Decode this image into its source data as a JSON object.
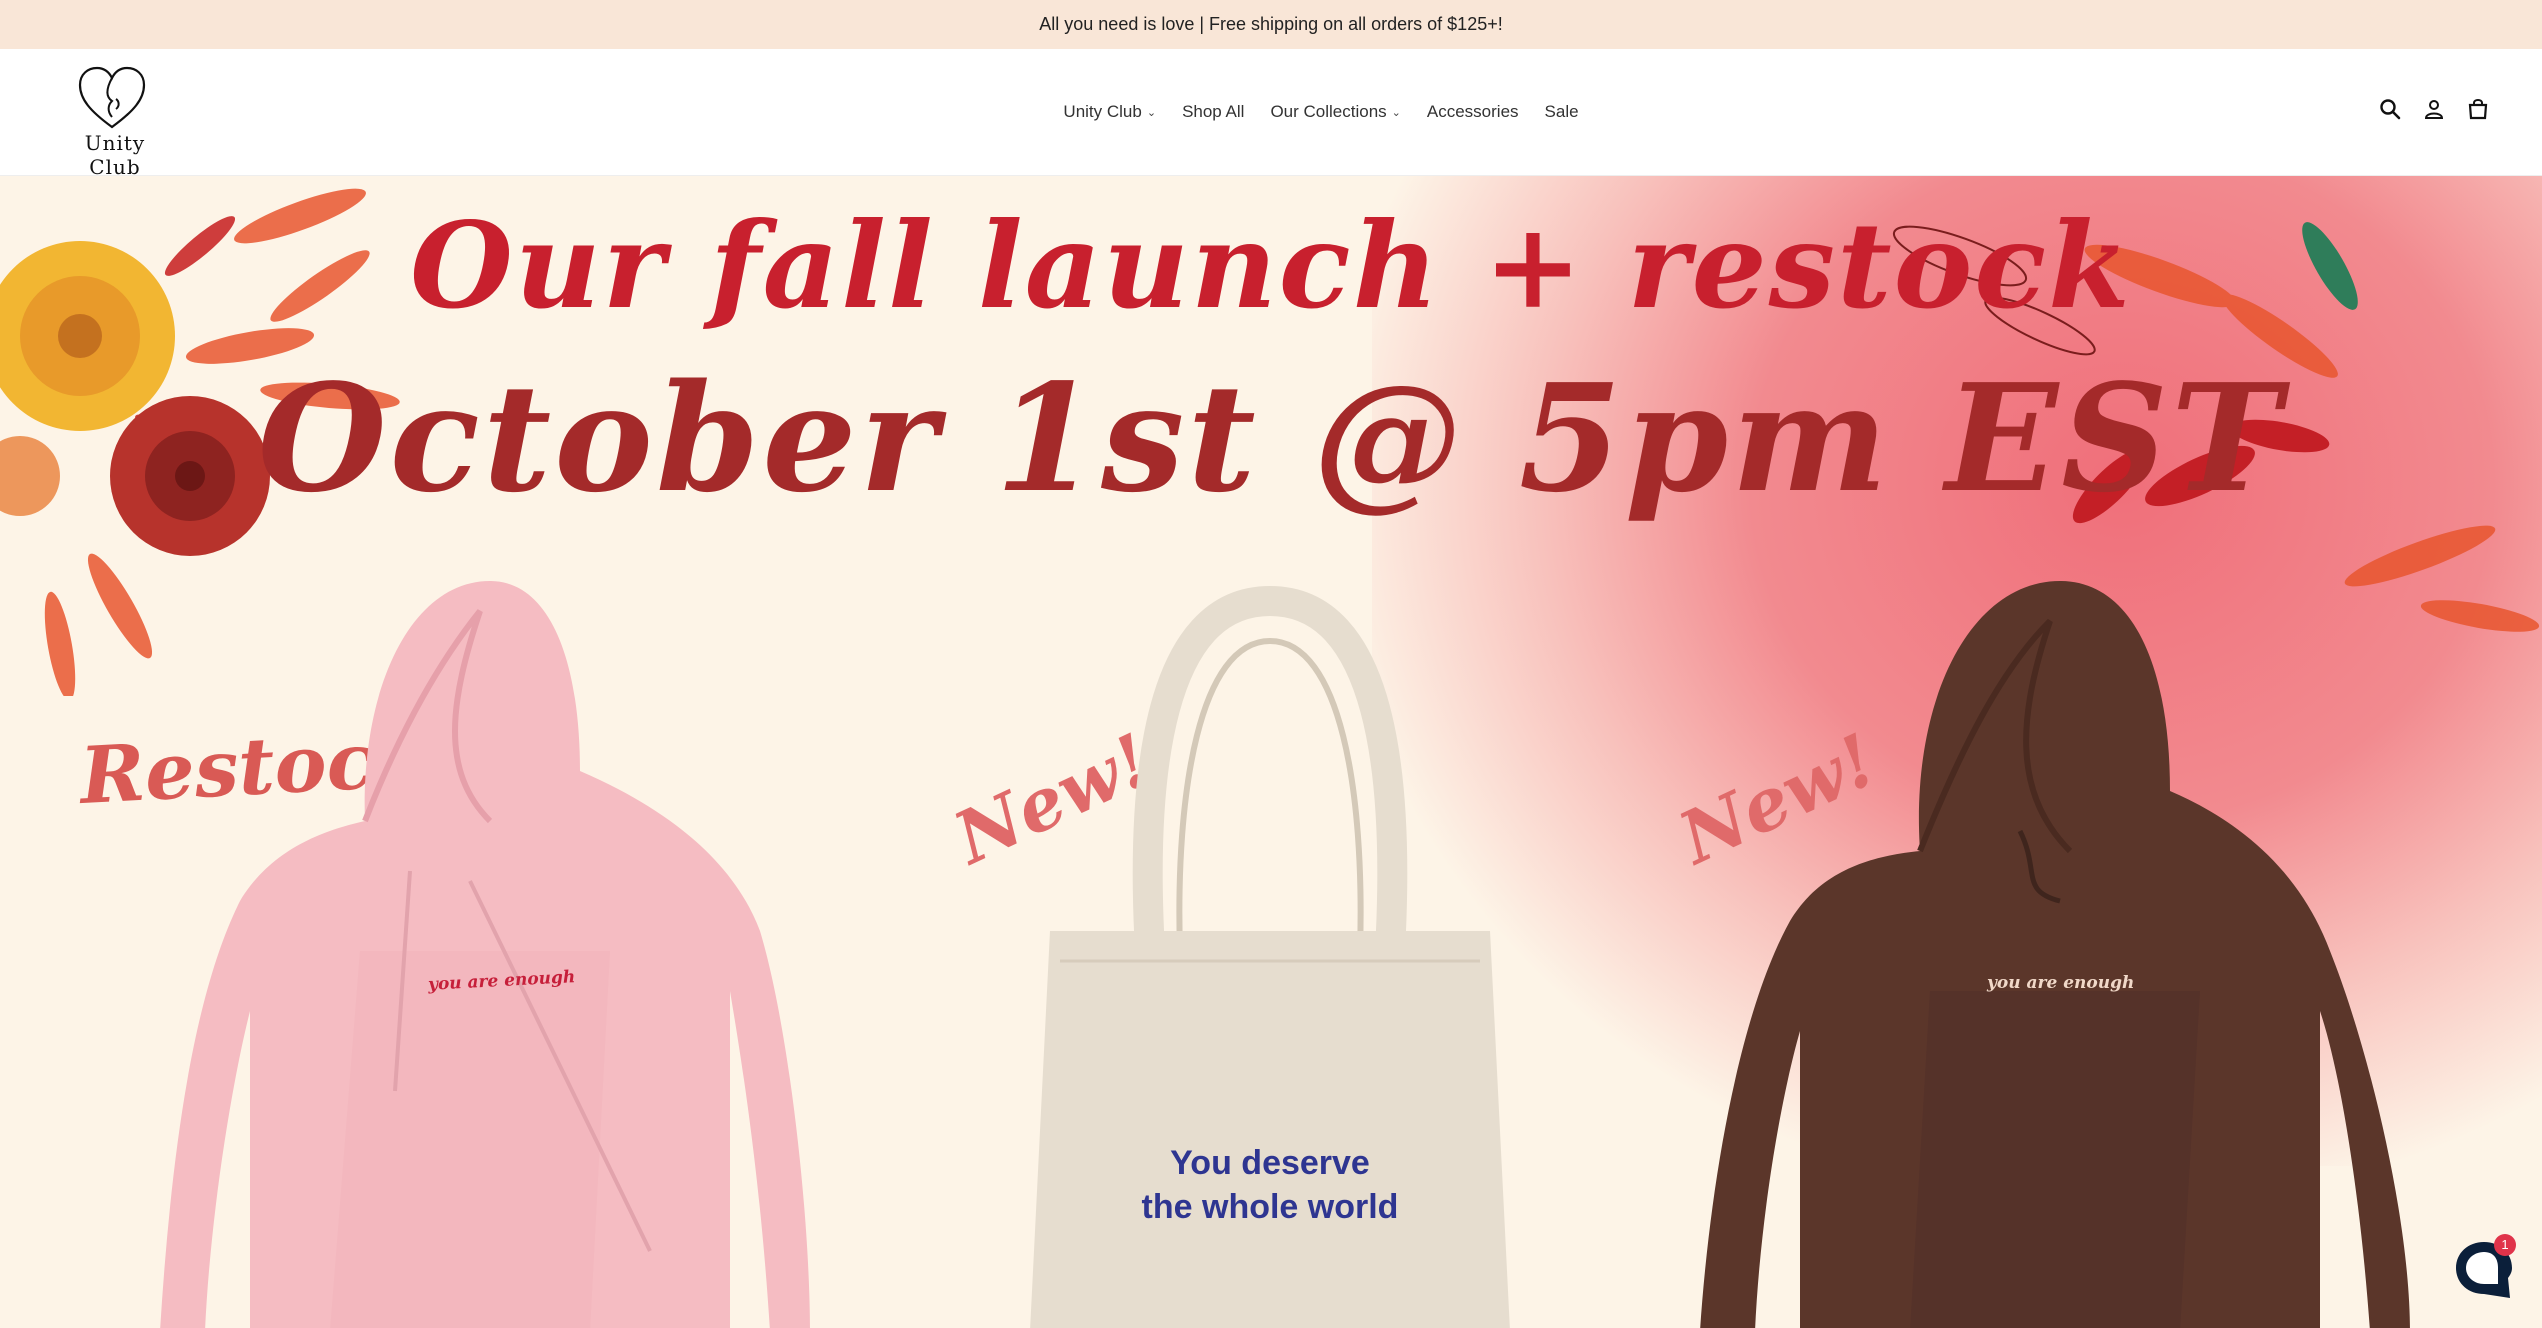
{
  "announcement": "All you need is love | Free shipping on all orders of $125+!",
  "brand": {
    "name": "Unity Club"
  },
  "nav": {
    "items": [
      {
        "label": "Unity Club",
        "dropdown": true
      },
      {
        "label": "Shop All",
        "dropdown": false
      },
      {
        "label": "Our Collections",
        "dropdown": true
      },
      {
        "label": "Accessories",
        "dropdown": false
      },
      {
        "label": "Sale",
        "dropdown": false
      }
    ]
  },
  "header_icons": [
    "search-icon",
    "account-icon",
    "cart-icon"
  ],
  "hero": {
    "headline_line1": "Our fall launch + restock",
    "headline_line2": "October 1st @ 5pm EST",
    "tags": {
      "restock": "Restock!",
      "new_tote": "New!",
      "new_hoodie": "New!"
    },
    "products": {
      "pink_hoodie_print": "you are enough",
      "tote_print_line1": "You deserve",
      "tote_print_line2": "the whole world",
      "brown_hoodie_print": "you are enough"
    }
  },
  "chat": {
    "unread_count": "1"
  },
  "colors": {
    "announcement_bg": "#f9e6d7",
    "hero_bg": "#fdf4e7",
    "headline_red": "#c8202e",
    "headline_brown": "#a42a2a",
    "pink_hoodie": "#f5bcc2",
    "brown_hoodie": "#5b362a",
    "tote": "#e6ddcf",
    "tote_text": "#2e3591"
  }
}
